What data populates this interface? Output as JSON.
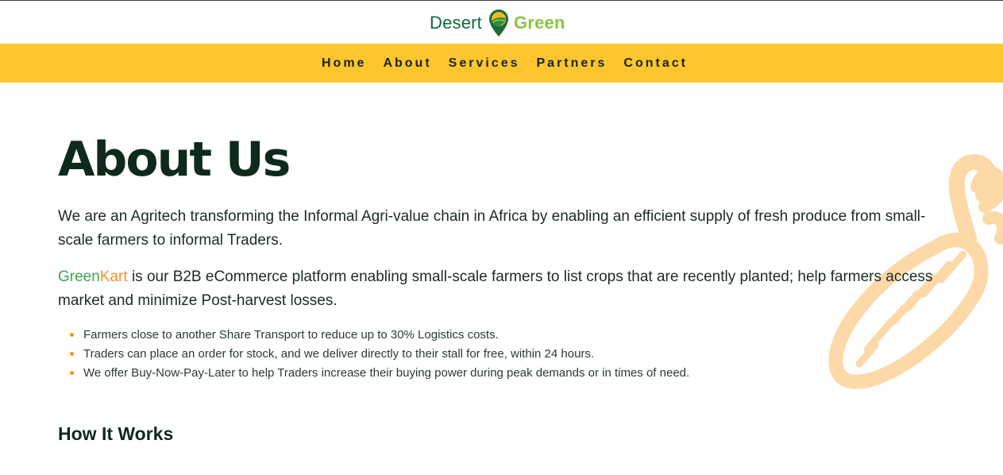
{
  "header": {
    "logo_left": "Desert",
    "logo_right": "Green"
  },
  "nav": {
    "items": [
      {
        "label": "Home"
      },
      {
        "label": "About"
      },
      {
        "label": "Services"
      },
      {
        "label": "Partners"
      },
      {
        "label": "Contact"
      }
    ]
  },
  "about": {
    "title": "About Us",
    "intro": "We are an Agritech transforming the Informal Agri-value chain in Africa by enabling an efficient supply of fresh produce from small-scale farmers to informal Traders.",
    "brand_green": "Green",
    "brand_kart": "Kart",
    "platform_text": " is our B2B eCommerce platform enabling small-scale farmers to list crops that are recently planted; help farmers access market and minimize Post-harvest losses.",
    "bullets": [
      "Farmers close to another Share Transport to reduce up to 30% Logistics costs.",
      "Traders can place an order for stock, and we deliver directly to their stall for free, within 24 hours.",
      "We offer Buy-Now-Pay-Later to help Traders increase their buying power during peak demands or in times of need."
    ]
  },
  "how_it_works": {
    "heading": "How It Works"
  },
  "colors": {
    "nav_bg": "#ffc530",
    "brand_dark_green": "#0f6a3a",
    "brand_light_green": "#8bc53f",
    "accent_orange": "#f0922b",
    "carrot_tint": "#fdd9a8"
  },
  "icons": {
    "logo_pin": "map-pin-leaf-icon",
    "decoration": "carrot-icon"
  }
}
